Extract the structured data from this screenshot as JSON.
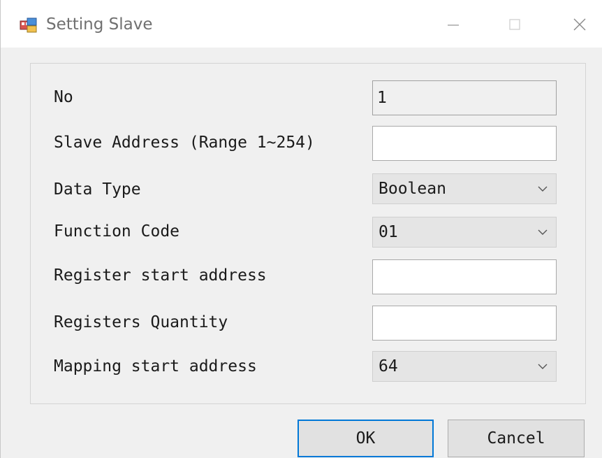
{
  "window": {
    "title": "Setting Slave",
    "icons": {
      "app": "app-icon",
      "minimize": "minimize-icon",
      "maximize": "maximize-icon",
      "close": "close-icon"
    }
  },
  "form": {
    "no_label": "No",
    "no_value": "1",
    "slave_address_label": "Slave Address (Range 1~254)",
    "slave_address_value": "",
    "data_type_label": "Data Type",
    "data_type_value": "Boolean",
    "function_code_label": "Function Code",
    "function_code_value": "01",
    "register_start_label": "Register start address",
    "register_start_value": "",
    "registers_quantity_label": "Registers Quantity",
    "registers_quantity_value": "",
    "mapping_start_label": "Mapping start address",
    "mapping_start_value": "64"
  },
  "buttons": {
    "ok": "OK",
    "cancel": "Cancel"
  },
  "colors": {
    "window_bg": "#f0f0f0",
    "titlebar_bg": "#ffffff",
    "focus_border": "#0078d7"
  }
}
